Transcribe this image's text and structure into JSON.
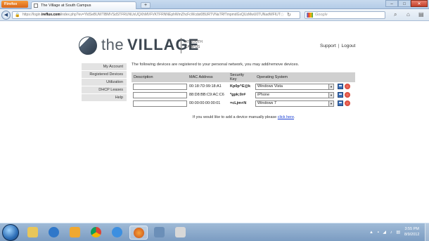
{
  "browser": {
    "app_button": "Firefox",
    "tab_title": "The Village at South Campus",
    "url_prefix": "https://login.",
    "url_domain": "ireflux.com",
    "url_rest": "/index.php?ev=YldSeBUWTlBMVSdSTFRUNUxUQXhMVFVKTFRNNEphWmZhcFcWcdst0BURTVNaTRfTmpmdGxQUzMwU0TUNadWFIUT",
    "search_placeholder": "Google"
  },
  "header": {
    "logo_the": "the",
    "logo_village": "VILLAGE",
    "logo_sub": "AT SOUTH CAMPUS",
    "support_link": "Support",
    "link_separator": "|",
    "logout_link": "Logout"
  },
  "sidebar": {
    "items": [
      {
        "label": "My Account"
      },
      {
        "label": "Registered Devices"
      },
      {
        "label": "Utilization"
      },
      {
        "label": "DHCP Leases"
      },
      {
        "label": "Help"
      }
    ]
  },
  "main": {
    "intro": "The following devices are registered to your personal network, you may add/remove devices.",
    "columns": {
      "description": "Description",
      "mac": "MAC Address",
      "security_key_line1": "Security",
      "security_key_line2": "Key",
      "os": "Operating System"
    },
    "devices": [
      {
        "description": "",
        "mac": "00:18:7D:99:18:A1",
        "key": "Kp0p^E@k",
        "os": "Windows Vista"
      },
      {
        "description": "",
        "mac": "88:D8:BB:C9:AC:C6",
        "key": "*gpk;0r#",
        "os": "iPhone"
      },
      {
        "description": "",
        "mac": "00:00:00:00:00:01",
        "key": "=cLjm+N",
        "os": "Windows 7"
      }
    ],
    "manual_note": "If you would like to add a device manually please ",
    "manual_link": "click here",
    "manual_tail": "."
  },
  "taskbar": {
    "time": "3:55 PM",
    "date": "8/9/2012"
  },
  "colors": {
    "brand_dark": "#3c4650",
    "link": "#1a3fd4",
    "table_header": "#d0d0d0",
    "sidebar_bg": "#e3e3e3"
  }
}
